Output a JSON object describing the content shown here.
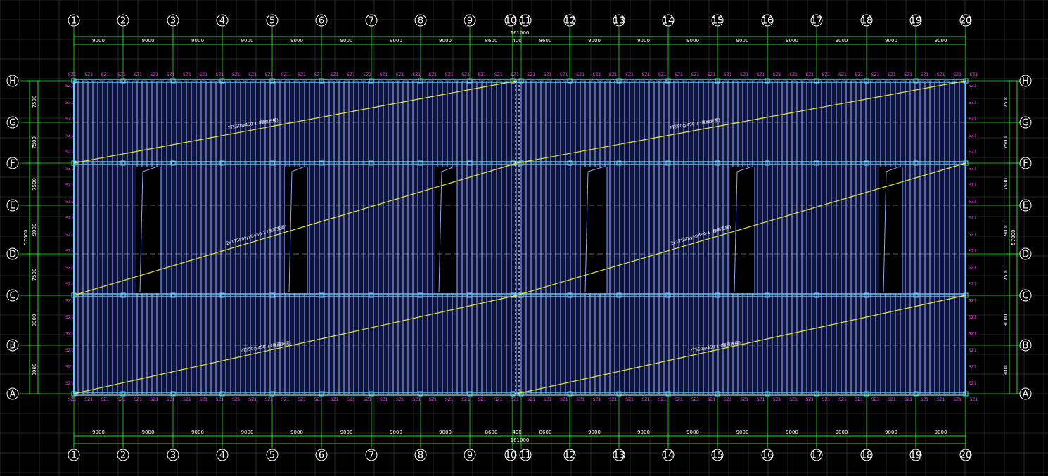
{
  "columns": [
    "1",
    "2",
    "3",
    "4",
    "5",
    "6",
    "7",
    "8",
    "9",
    "10",
    "11",
    "12",
    "13",
    "14",
    "15",
    "16",
    "17",
    "18",
    "19",
    "20"
  ],
  "rows": [
    "H",
    "G",
    "F",
    "E",
    "D",
    "C",
    "B",
    "A"
  ],
  "top_spans": [
    "9000",
    "9000",
    "9000",
    "9000",
    "9000",
    "9000",
    "9000",
    "9000",
    "8600",
    "400",
    "8600",
    "9000",
    "9000",
    "9000",
    "9000",
    "9000",
    "9000",
    "9000",
    "9000"
  ],
  "bottom_spans": [
    "9000",
    "9000",
    "9000",
    "9000",
    "9000",
    "9000",
    "9000",
    "9000",
    "8600",
    "400",
    "8600",
    "9000",
    "9000",
    "9000",
    "9000",
    "9000",
    "9000",
    "9000",
    "9000"
  ],
  "total_length": "161000",
  "left_spans": [
    "7500",
    "7500",
    "7500",
    "9000",
    "7500",
    "9000",
    "9000"
  ],
  "right_spans": [
    "7500",
    "7500",
    "7500",
    "9000",
    "7500",
    "9000",
    "9000"
  ],
  "total_width": "57000",
  "tag_label": "SZ1",
  "brace_notes": [
    "2TS50@450-1 (屋面支撑)",
    "2TS50@450-1 (屋面支撑)",
    "2x1TS50(y)@450-1 (屋面支撑)",
    "2x1TS50(y)@450-1 (屋面支撑)",
    "2TS50@450-1 (屋面支撑)",
    "2TS50@450-1 (屋面支撑)"
  ],
  "colors": {
    "background": "#000000",
    "grid": "#262626",
    "axis": "#ffffff",
    "dimension": "#22dd22",
    "tags": "#ff33ff",
    "purlins": "#8aa6ff",
    "beams": "#66ccff",
    "bracing": "#e6e633"
  }
}
